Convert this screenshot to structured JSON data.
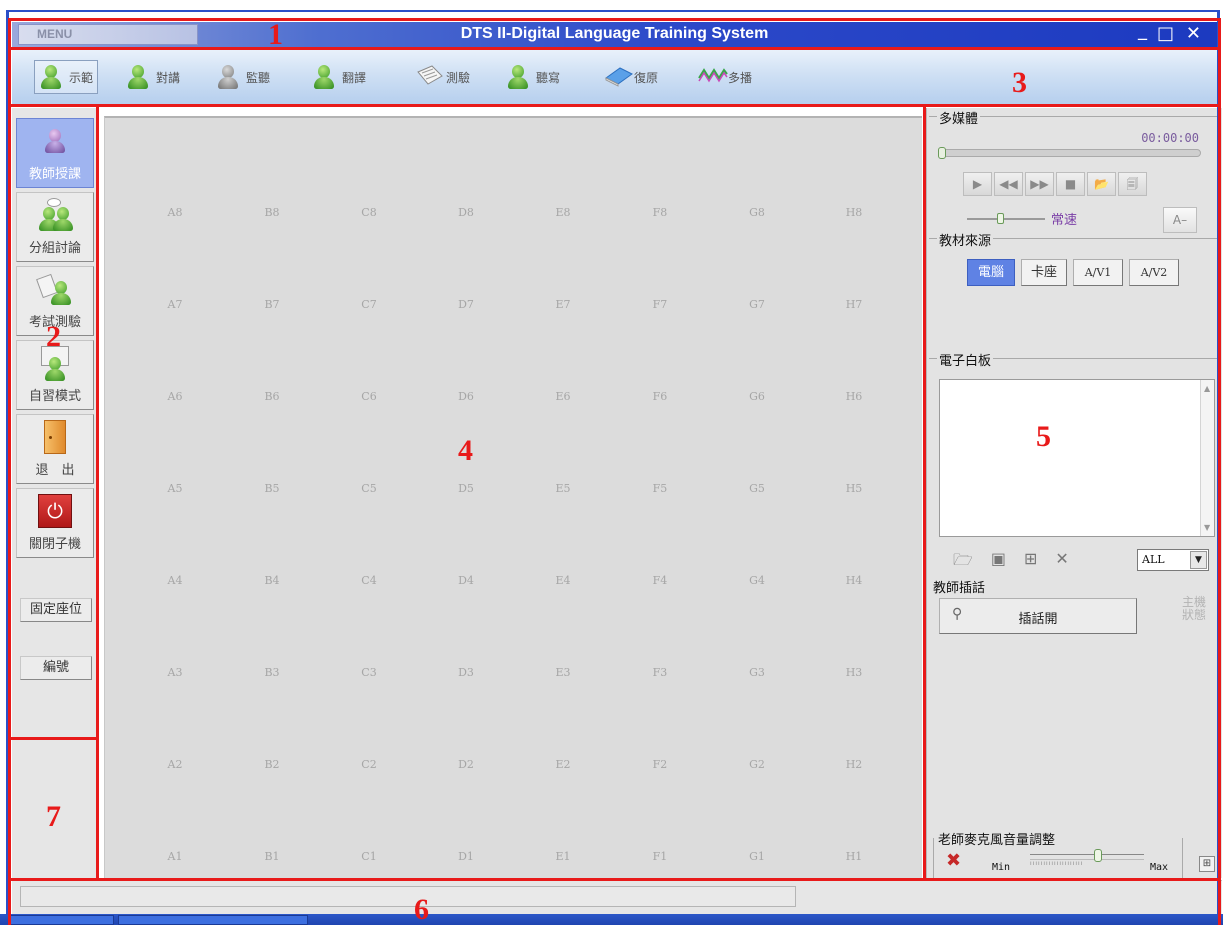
{
  "window": {
    "menu_label": "MENU",
    "title": "DTS II-Digital Language Training System",
    "minimize": "_",
    "maximize": "□",
    "close": "✕"
  },
  "toolbar": {
    "items": [
      {
        "label": "示範",
        "icon": "teacher-demo-icon",
        "active": true
      },
      {
        "label": "對講",
        "icon": "intercom-icon"
      },
      {
        "label": "監聽",
        "icon": "monitor-icon"
      },
      {
        "label": "翻譯",
        "icon": "translate-icon"
      },
      {
        "label": "測驗",
        "icon": "test-paper-icon"
      },
      {
        "label": "聽寫",
        "icon": "dictation-icon"
      },
      {
        "label": "復原",
        "icon": "eraser-icon"
      },
      {
        "label": "多播",
        "icon": "multicast-wave-icon"
      }
    ]
  },
  "sidebar": {
    "modes": [
      {
        "label": "教師授課",
        "icon": "teacher-lecture-icon",
        "active": true
      },
      {
        "label": "分組討論",
        "icon": "group-discussion-icon"
      },
      {
        "label": "考試測驗",
        "icon": "exam-icon"
      },
      {
        "label": "自習模式",
        "icon": "self-study-icon"
      },
      {
        "label": "退　出",
        "icon": "exit-door-icon"
      },
      {
        "label": "關閉子機",
        "icon": "power-off-icon"
      }
    ],
    "fixed_seat": "固定座位",
    "numbering": "編號"
  },
  "seats": {
    "columns": [
      "A",
      "B",
      "C",
      "D",
      "E",
      "F",
      "G",
      "H"
    ],
    "rows": [
      8,
      7,
      6,
      5,
      4,
      3,
      2,
      1
    ]
  },
  "multimedia": {
    "title": "多媒體",
    "time": "00:00:00",
    "progress": 0,
    "buttons": [
      {
        "symbol": "▶",
        "name": "play"
      },
      {
        "symbol": "◀◀",
        "name": "rewind"
      },
      {
        "symbol": "▶▶",
        "name": "fast-forward"
      },
      {
        "symbol": "■",
        "name": "stop"
      },
      {
        "symbol": "📂",
        "name": "open-file"
      },
      {
        "symbol": "🗐",
        "name": "playlist"
      }
    ],
    "speed_label": "常速",
    "a_minus": "A–"
  },
  "source": {
    "title": "教材來源",
    "options": [
      {
        "label": "電腦",
        "active": true
      },
      {
        "label": "卡座"
      },
      {
        "label": "A/V1"
      },
      {
        "label": "A/V2"
      }
    ]
  },
  "whiteboard": {
    "title": "電子白板",
    "filter_value": "ALL",
    "tools": [
      "open-file-icon",
      "save-icon",
      "insert-icon",
      "delete-icon"
    ]
  },
  "interject": {
    "title": "教師插話",
    "button_label": "插話開",
    "host_status": "主機狀態"
  },
  "mic": {
    "title": "老師麥克風音量調整",
    "min_label": "Min",
    "max_label": "Max",
    "volume_fraction": 0.6
  },
  "annotations": [
    "1",
    "2",
    "3",
    "4",
    "5",
    "6",
    "7"
  ],
  "colors": {
    "annotation": "#e81a1a",
    "title_bar": "#2c49c9",
    "active_mode": "#9fb4f0",
    "active_source": "#5f82e4"
  }
}
